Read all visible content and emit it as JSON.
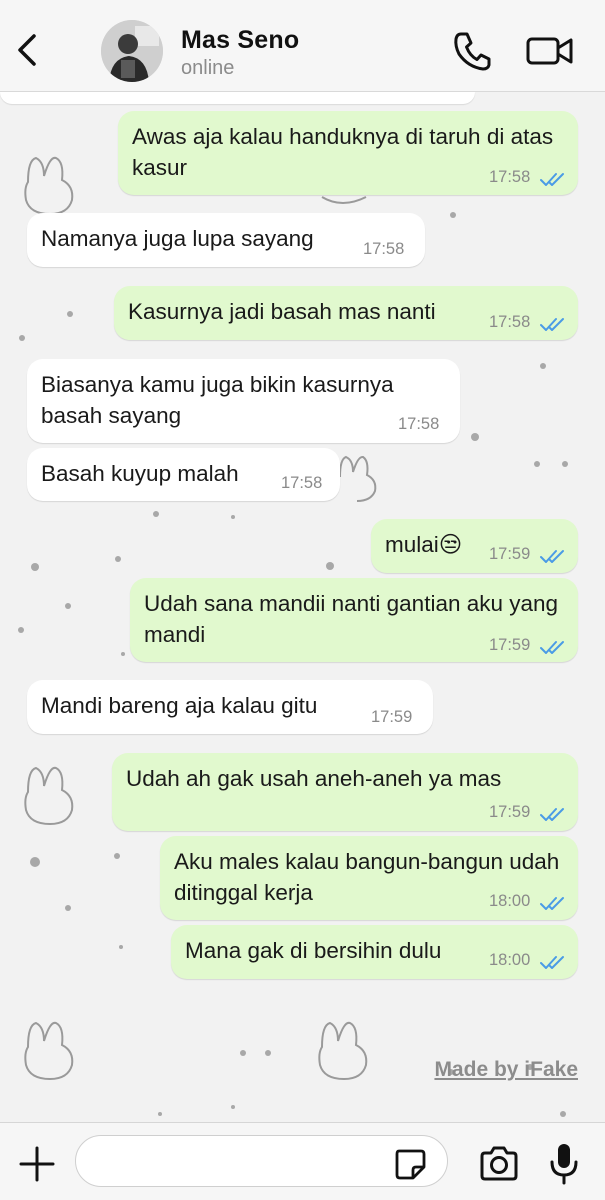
{
  "header": {
    "name": "Mas Seno",
    "status": "online"
  },
  "messages": [
    {
      "dir": "out",
      "text": "Awas aja kalau handuknya di taruh di atas kasur",
      "time": "17:58",
      "status": "read"
    },
    {
      "dir": "in",
      "text": "Namanya juga lupa sayang",
      "time": "17:58"
    },
    {
      "dir": "out",
      "text": "Kasurnya jadi basah mas nanti",
      "time": "17:58",
      "status": "read"
    },
    {
      "dir": "in",
      "text": "Biasanya kamu juga bikin kasurnya basah sayang",
      "time": "17:58"
    },
    {
      "dir": "in",
      "text": "Basah kuyup malah",
      "time": "17:58"
    },
    {
      "dir": "out",
      "text": "mulai😒",
      "time": "17:59",
      "status": "read"
    },
    {
      "dir": "out",
      "text": "Udah sana mandii nanti gantian aku yang mandi",
      "time": "17:59",
      "status": "read"
    },
    {
      "dir": "in",
      "text": "Mandi bareng aja kalau gitu",
      "time": "17:59"
    },
    {
      "dir": "out",
      "text": "Udah ah gak usah aneh-aneh ya mas",
      "time": "17:59",
      "status": "read"
    },
    {
      "dir": "out",
      "text": "Aku males kalau bangun-bangun udah ditinggal kerja",
      "time": "18:00",
      "status": "read"
    },
    {
      "dir": "out",
      "text": "Mana gak di bersihin dulu",
      "time": "18:00",
      "status": "read"
    }
  ],
  "watermark": "Made by iFake",
  "composer": {
    "placeholder": "",
    "icons": [
      "plus-icon",
      "sticker-icon",
      "camera-icon",
      "microphone-icon"
    ]
  },
  "colors": {
    "outgoing_bubble": "#e1f9ce",
    "incoming_bubble": "#ffffff",
    "read_ticks": "#4a9be6"
  }
}
